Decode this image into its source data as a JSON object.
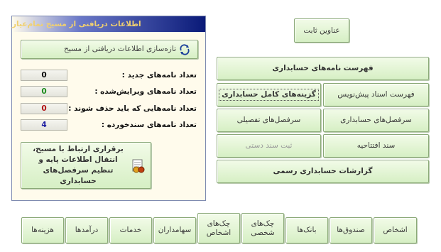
{
  "colors": {
    "new": "#000000",
    "edited": "#1a8a1a",
    "to_delete": "#b01010",
    "documented": "#1a1aa0"
  },
  "fixed_titles_button": "عناوین ثابت",
  "menu": {
    "accounting_letters_list": "فهرست نامه‌های حسابداری",
    "draft_documents_list": "فهرست اسناد پیش‌نویس",
    "accounting_letter_options": "گزینه‌های کامل حسابداری",
    "accounting_ledger_heads": "سرفصل‌های حسابداری",
    "detailed_ledger_heads": "سرفصل‌های تفصیلی",
    "opening_document": "سند افتتاحیه",
    "manual_document_entry": "ثبت سند دستی",
    "official_accounting_reports": "گزارشات حسابداری رسمی"
  },
  "panel": {
    "title": "اطلاعات دریافتی از مسیح تمام‌عیار",
    "refresh_label": "تازه‌سازی اطلاعات دریافتی از مسیح",
    "rows": [
      {
        "label": "تعداد نامه‌های جدید :",
        "value": "0"
      },
      {
        "label": "تعداد نامه‌های ویرایش‌شده :",
        "value": "0"
      },
      {
        "label": "تعداد نامه‌هایی که باید حذف شوند :",
        "value": "0"
      },
      {
        "label": "تعداد نامه‌های سندخورده :",
        "value": "4"
      }
    ],
    "sync_label": "برقراری ارتباط با مسیح، انتقال اطلاعات پایه و تنظیم سرفصل‌های حسابداری"
  },
  "bottom_bar": {
    "persons": "اشخاص",
    "cash_boxes": "صندوق‌ها",
    "banks": "بانک‌ها",
    "personal_cheques": "چک‌های شخصی",
    "persons_cheques": "چک‌های اشخاص",
    "shareholders": "سهامداران",
    "services": "خدمات",
    "incomes": "درآمدها",
    "expenses": "هزینه‌ها"
  }
}
